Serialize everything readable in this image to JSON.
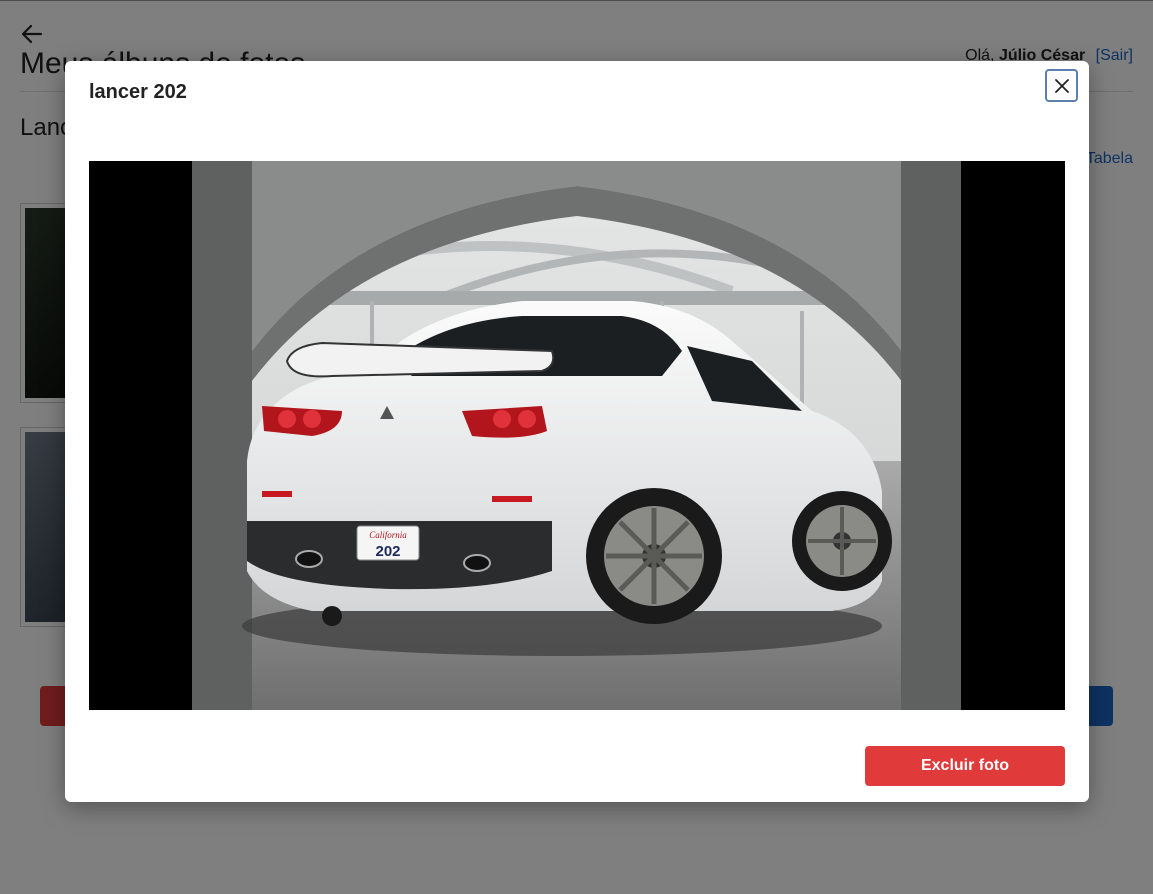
{
  "page": {
    "title": "Meus álbuns de fotos",
    "greeting": "Olá,",
    "user_name": "Júlio César",
    "logout_label": "[Sair]",
    "album_title": "Lancer",
    "view_toggle_label": "Tabela"
  },
  "modal": {
    "title": "lancer 202",
    "delete_label": "Excluir foto",
    "plate_text": "202",
    "plate_state": "California"
  },
  "colors": {
    "danger": "#e03a3a",
    "link": "#1d64c4"
  },
  "icons": {
    "back": "arrow-left-icon",
    "close": "close-icon"
  }
}
